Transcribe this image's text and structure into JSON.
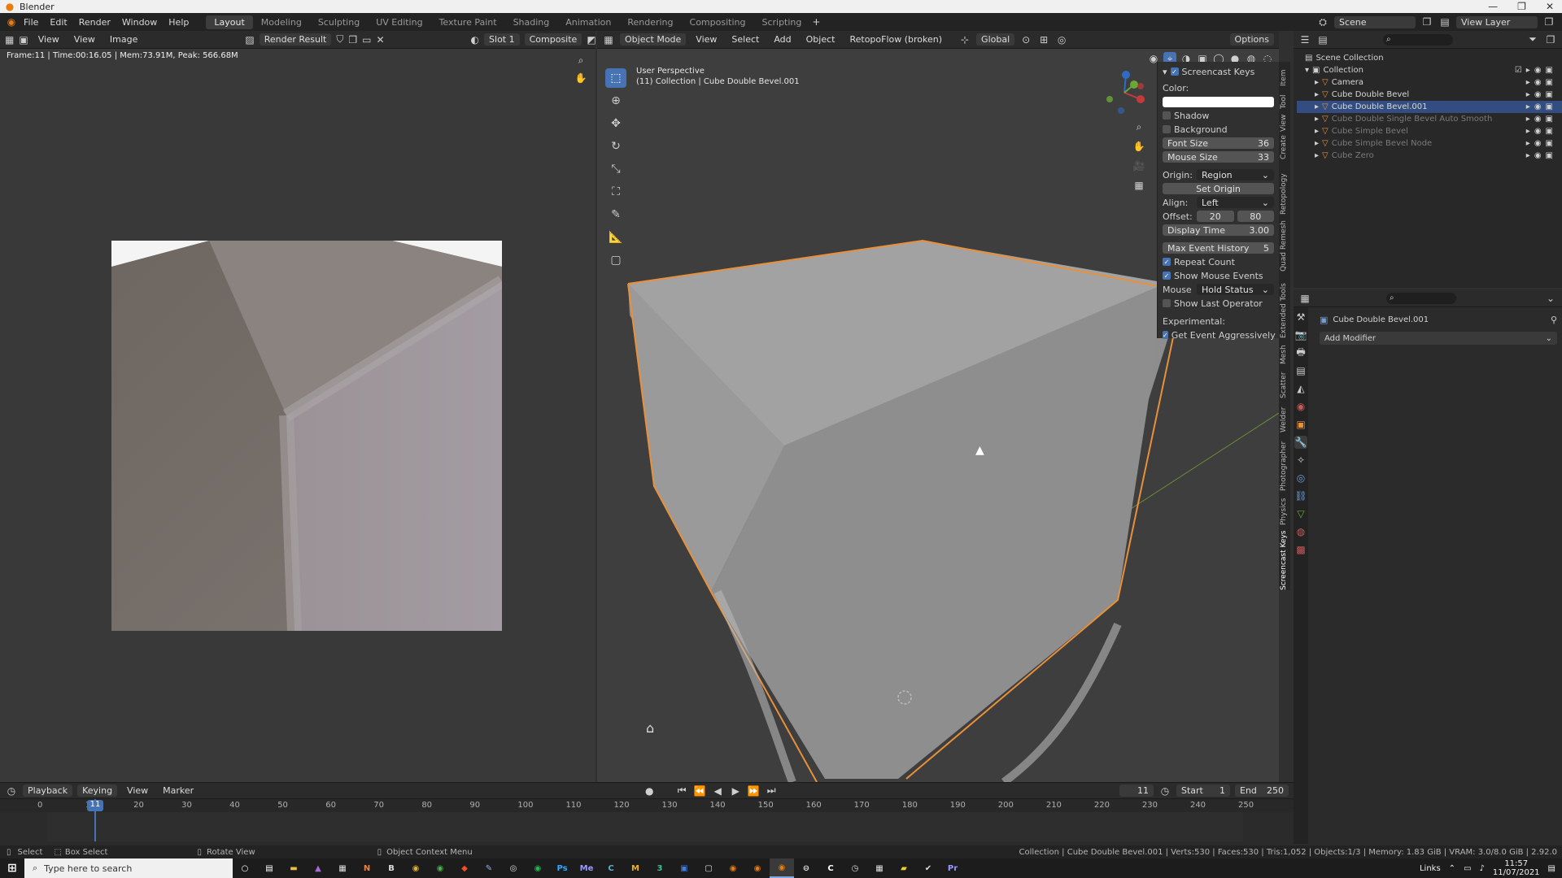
{
  "window": {
    "title": "Blender",
    "controls": [
      "—",
      "❐",
      "✕"
    ]
  },
  "menu": [
    "File",
    "Edit",
    "Render",
    "Window",
    "Help"
  ],
  "workspaces": [
    "Layout",
    "Modeling",
    "Sculpting",
    "UV Editing",
    "Texture Paint",
    "Shading",
    "Animation",
    "Rendering",
    "Compositing",
    "Scripting"
  ],
  "topbar": {
    "scene": "Scene",
    "view_layer": "View Layer"
  },
  "image_editor": {
    "menus": [
      "View",
      "View",
      "Image"
    ],
    "image_name": "Render Result",
    "slot": "Slot 1",
    "layer": "Composite",
    "info": "Frame:11 | Time:00:16.05 | Mem:73.91M, Peak: 566.68M"
  },
  "viewport": {
    "mode": "Object Mode",
    "menus": [
      "View",
      "Select",
      "Add",
      "Object"
    ],
    "addon_menu": "RetopoFlow (broken)",
    "orientation": "Global",
    "options": "Options",
    "perspective": "User Perspective",
    "collection_info": "(11) Collection | Cube Double Bevel.001"
  },
  "screencast": {
    "title": "Screencast Keys",
    "color_label": "Color:",
    "shadow": "Shadow",
    "background": "Background",
    "font_size_label": "Font Size",
    "font_size": "36",
    "mouse_size_label": "Mouse Size",
    "mouse_size": "33",
    "origin_label": "Origin:",
    "origin": "Region",
    "set_origin": "Set Origin",
    "align_label": "Align:",
    "align": "Left",
    "offset_label": "Offset:",
    "offset_x": "20",
    "offset_y": "80",
    "display_time_label": "Display Time",
    "display_time": "3.00",
    "max_event_label": "Max Event History",
    "max_event": "5",
    "repeat_count": "Repeat Count",
    "show_mouse_events": "Show Mouse Events",
    "mouse_label": "Mouse ...",
    "mouse_mode": "Hold Status",
    "show_last_operator": "Show Last Operator",
    "experimental": "Experimental:",
    "get_event": "Get Event Aggressively"
  },
  "ntabs": [
    "Item",
    "Tool",
    "View",
    "Create",
    "Retopology",
    "Quad Remesh",
    "Extended Tools",
    "Mesh",
    "Scatter",
    "Welder",
    "Photographer",
    "Physics",
    "Screencast Keys"
  ],
  "outliner": {
    "root": "Scene Collection",
    "collection": "Collection",
    "items": [
      {
        "name": "Camera",
        "dim": false,
        "selected": false
      },
      {
        "name": "Cube Double Bevel",
        "dim": false,
        "selected": false
      },
      {
        "name": "Cube Double Bevel.001",
        "dim": false,
        "selected": true
      },
      {
        "name": "Cube Double Single Bevel Auto Smooth",
        "dim": true,
        "selected": false
      },
      {
        "name": "Cube Simple Bevel",
        "dim": true,
        "selected": false
      },
      {
        "name": "Cube Simple Bevel Node",
        "dim": true,
        "selected": false
      },
      {
        "name": "Cube Zero",
        "dim": true,
        "selected": false
      }
    ]
  },
  "properties": {
    "object_name": "Cube Double Bevel.001",
    "add_modifier": "Add Modifier"
  },
  "timeline": {
    "menus": [
      "Playback",
      "Keying",
      "View",
      "Marker"
    ],
    "current_frame": "11",
    "start_label": "Start",
    "start": "1",
    "end_label": "End",
    "end": "250",
    "ticks": [
      "0",
      "10",
      "20",
      "30",
      "40",
      "50",
      "60",
      "70",
      "80",
      "90",
      "100",
      "110",
      "120",
      "130",
      "140",
      "150",
      "160",
      "170",
      "180",
      "190",
      "200",
      "210",
      "220",
      "230",
      "240",
      "250"
    ]
  },
  "status": {
    "select": "Select",
    "box_select": "Box Select",
    "rotate_view": "Rotate View",
    "context_menu": "Object Context Menu",
    "stats": "Collection | Cube Double Bevel.001 | Verts:530 | Faces:530 | Tris:1,052 | Objects:1/3 | Memory: 1.83 GiB | VRAM: 3.0/8.0 GiB | 2.92.0"
  },
  "taskbar": {
    "search_placeholder": "Type here to search",
    "links": "Links",
    "time": "11:57",
    "date": "11/07/2021"
  },
  "colors": {
    "accent": "#4772b3",
    "selection_outline": "#e8903a",
    "panel": "#303030",
    "header": "#2b2b2b"
  }
}
